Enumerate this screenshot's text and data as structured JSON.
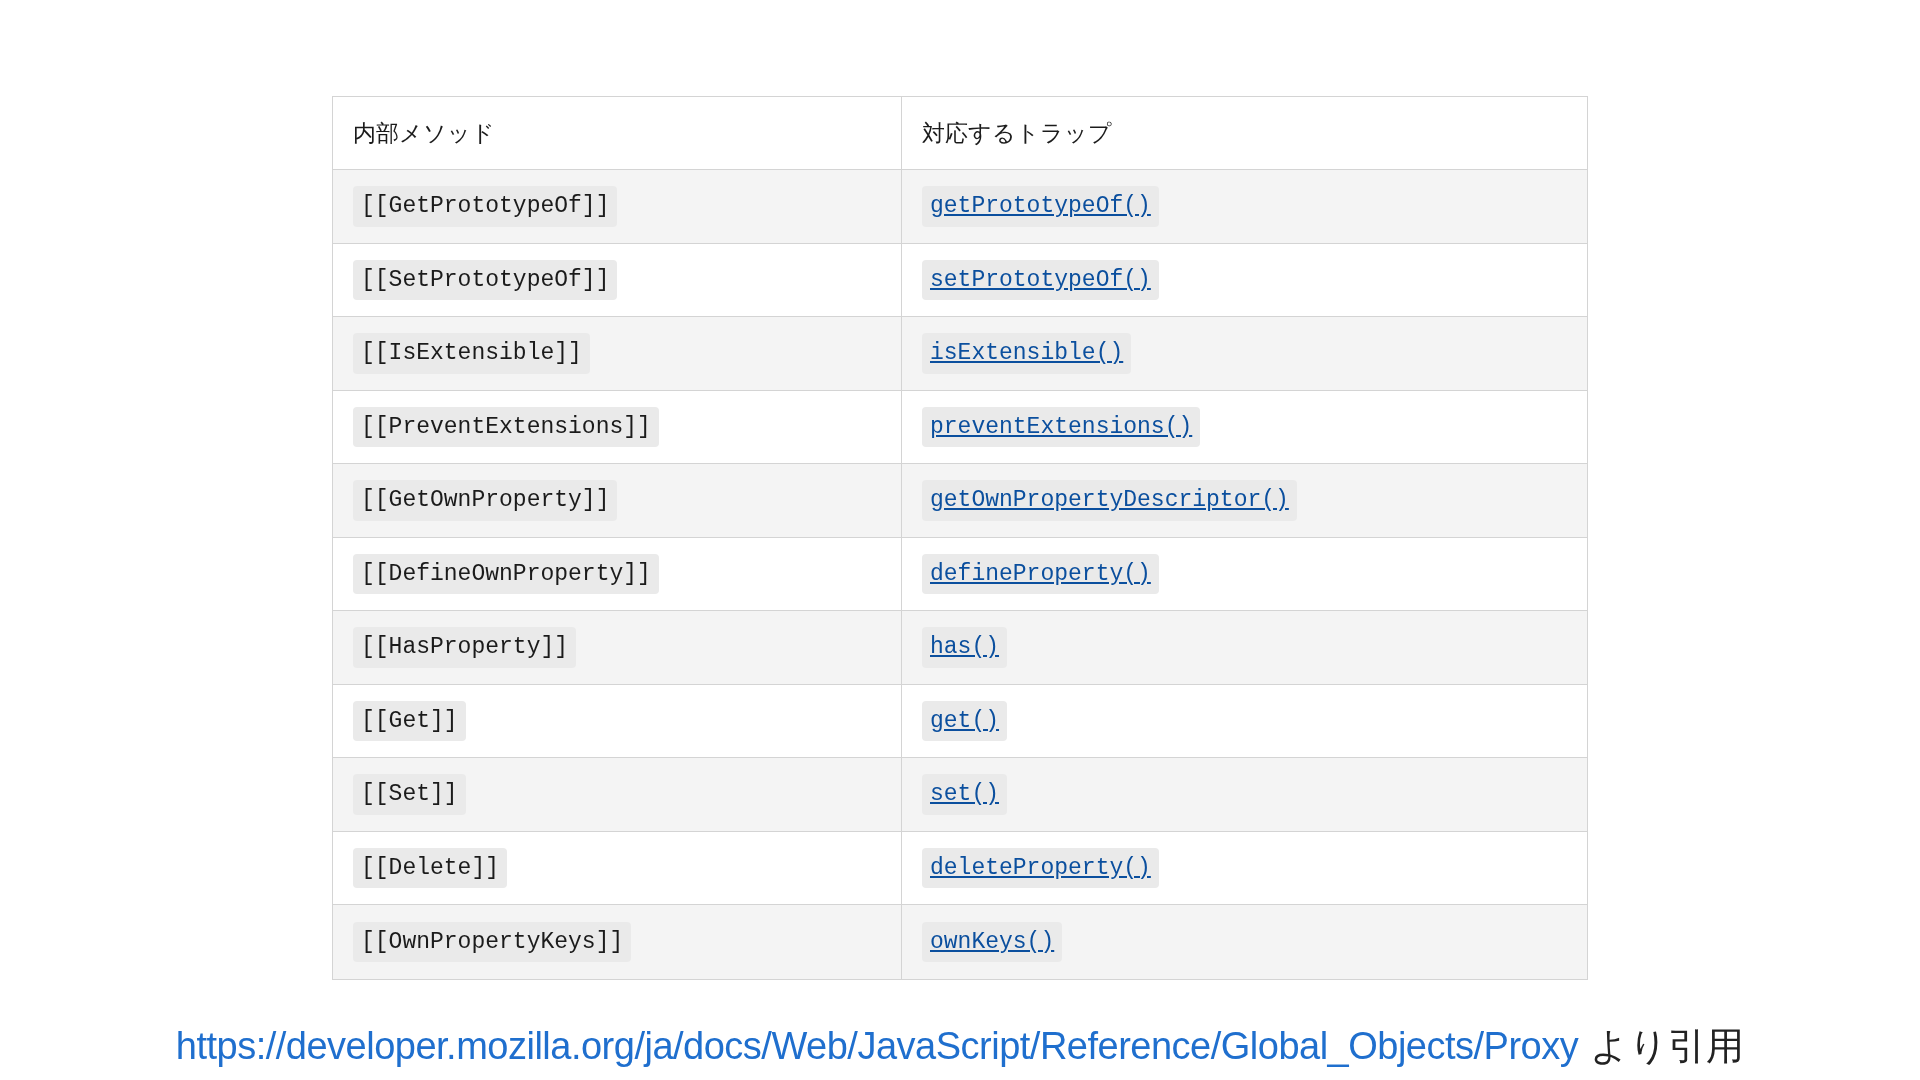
{
  "table": {
    "columns": [
      "内部メソッド",
      "対応するトラップ"
    ],
    "rows": [
      {
        "method": "[[GetPrototypeOf]]",
        "trap": "getPrototypeOf()"
      },
      {
        "method": "[[SetPrototypeOf]]",
        "trap": "setPrototypeOf()"
      },
      {
        "method": "[[IsExtensible]]",
        "trap": "isExtensible()"
      },
      {
        "method": "[[PreventExtensions]]",
        "trap": "preventExtensions()"
      },
      {
        "method": "[[GetOwnProperty]]",
        "trap": "getOwnPropertyDescriptor()"
      },
      {
        "method": "[[DefineOwnProperty]]",
        "trap": "defineProperty()"
      },
      {
        "method": "[[HasProperty]]",
        "trap": "has()"
      },
      {
        "method": "[[Get]]",
        "trap": "get()"
      },
      {
        "method": "[[Set]]",
        "trap": "set()"
      },
      {
        "method": "[[Delete]]",
        "trap": "deleteProperty()"
      },
      {
        "method": "[[OwnPropertyKeys]]",
        "trap": "ownKeys()"
      }
    ]
  },
  "caption": {
    "url": "https://developer.mozilla.org/ja/docs/Web/JavaScript/Reference/Global_Objects/Proxy",
    "suffix": "より引用"
  }
}
